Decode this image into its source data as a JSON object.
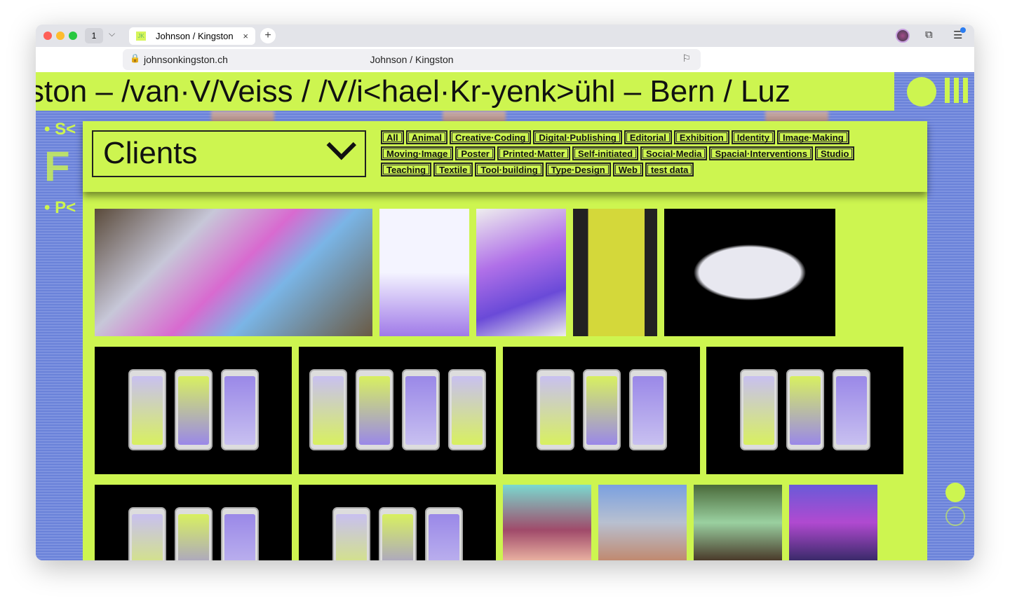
{
  "browser": {
    "tab_count": "1",
    "tab_title": "Johnson / Kingston",
    "url": "johnsonkingston.ch",
    "page_title": "Johnson / Kingston"
  },
  "marquee": {
    "text": "ston – /van·V/Veiss / /V/i<hael·Kr-yenk>ühl – Bern / Luz"
  },
  "side": {
    "s": "• S<",
    "f": "F",
    "p": "• P<"
  },
  "filter": {
    "selected": "Clients",
    "tags": [
      [
        "All",
        "Animal",
        "Creative·Coding",
        "Digital·Publishing",
        "Editorial",
        "Exhibition",
        "Identity",
        "Image·Making"
      ],
      [
        "Moving·Image",
        "Poster",
        "Printed·Matter",
        "Self-initiated",
        "Social·Media",
        "Spacial·Interventions",
        "Studio"
      ],
      [
        "Teaching",
        "Textile",
        "Tool·building",
        "Type·Design",
        "Web",
        "test data"
      ]
    ]
  },
  "colors": {
    "accent": "#cdf550",
    "background": "#7088dc"
  }
}
